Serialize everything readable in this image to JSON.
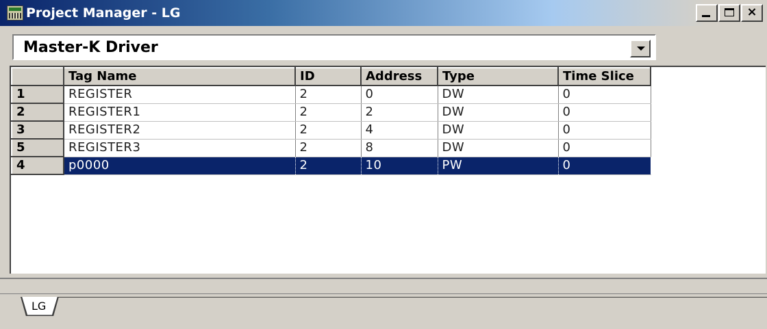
{
  "window": {
    "title": "Project Manager - LG",
    "controls": {
      "minimize": "_",
      "maximize": "□",
      "close": "×"
    }
  },
  "driver_select": {
    "value": "Master-K Driver"
  },
  "grid": {
    "columns": [
      "",
      "Tag Name",
      "ID",
      "Address",
      "Type",
      "Time Slice"
    ],
    "rows": [
      {
        "num": "1",
        "tag": "REGISTER",
        "id": "2",
        "address": "0",
        "type": "DW",
        "slice": "0"
      },
      {
        "num": "2",
        "tag": "REGISTER1",
        "id": "2",
        "address": "2",
        "type": "DW",
        "slice": "0"
      },
      {
        "num": "3",
        "tag": "REGISTER2",
        "id": "2",
        "address": "4",
        "type": "DW",
        "slice": "0"
      },
      {
        "num": "5",
        "tag": "REGISTER3",
        "id": "2",
        "address": "8",
        "type": "DW",
        "slice": "0"
      },
      {
        "num": "4",
        "tag": "p0000",
        "id": "2",
        "address": "10",
        "type": "PW",
        "slice": "0"
      }
    ],
    "selected_row": 4
  },
  "tabs": [
    {
      "label": "LG"
    }
  ],
  "colors": {
    "selection": "#0a246a",
    "face": "#d4d0c8",
    "titlebar_start": "#0a246a"
  }
}
